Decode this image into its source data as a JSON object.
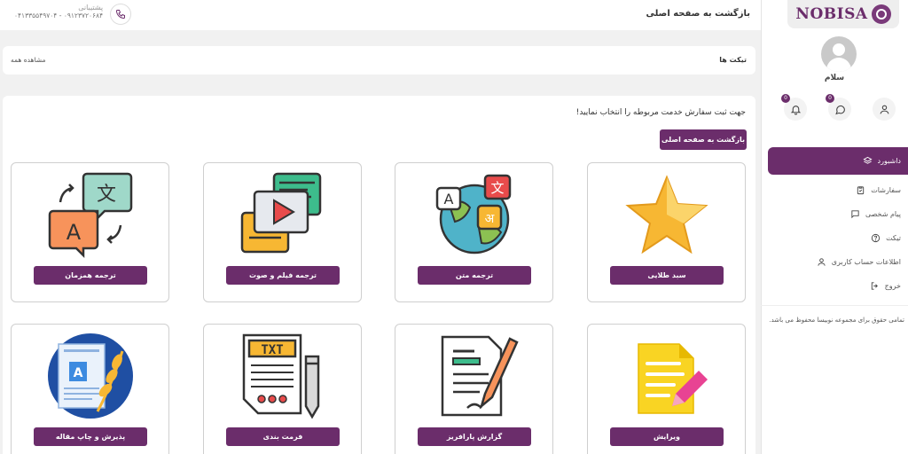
{
  "header": {
    "back_home": "بازگشت به صفحه اصلی",
    "support_label": "پشتیبانی",
    "support_numbers": "۰۹۱۲۳۷۲۰۶۸۴ - ۰۴۱۳۳۵۵۴۹۷۰۴"
  },
  "sidebar": {
    "logo": "NOBISA",
    "greeting": "سلام",
    "badges": {
      "messages": "0",
      "notifications": "0"
    },
    "items": [
      {
        "label": "داشبورد"
      },
      {
        "label": "سفارشات"
      },
      {
        "label": "پیام شخصی"
      },
      {
        "label": "تیکت"
      },
      {
        "label": "اطلاعات حساب کاربری"
      },
      {
        "label": "خروج"
      }
    ],
    "copyright": "تمامی حقوق برای مجموعه نوبیسا محفوظ می باشد."
  },
  "tickets": {
    "title": "تیکت ها",
    "view_all": "مشاهده همه"
  },
  "main": {
    "instruction": "جهت ثبت سفارش خدمت مربوطه را انتخاب نمایید!",
    "back_button": "بازگشت به صفحه اصلی",
    "services": [
      {
        "label": "سبد طلایی"
      },
      {
        "label": "ترجمه متن"
      },
      {
        "label": "ترجمه فیلم و صوت"
      },
      {
        "label": "ترجمه همزمان"
      },
      {
        "label": "ویرایش"
      },
      {
        "label": "گزارش پارافریز"
      },
      {
        "label": "فرمت بندی"
      },
      {
        "label": "پذیرش و چاپ مقاله"
      }
    ]
  },
  "colors": {
    "accent": "#6b2d6b",
    "background": "#f1f1f1"
  }
}
